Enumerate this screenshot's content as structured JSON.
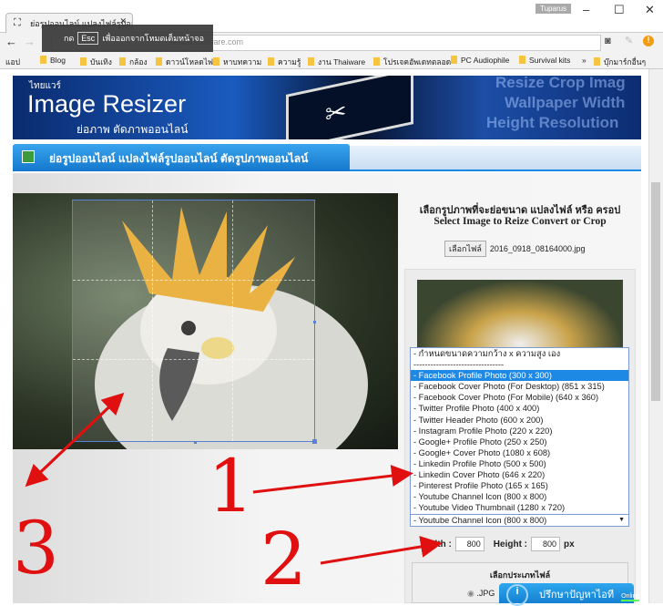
{
  "browser": {
    "tab_title": "ย่อรูปออนไลน์ แปลงไฟล์รูปออ",
    "user": "Tuparus",
    "url": "resize.thaiware.com",
    "esc_prefix": "กด",
    "esc_key": "Esc",
    "esc_text": "เพื่อออกจากโหมดเต็มหน้าจอ",
    "bookmarks": [
      "แอป",
      "Blog",
      "บันเทิง",
      "กล้อง",
      "ดาวน์โหลดไฟล์",
      "หาบทความ",
      "ความรู้",
      "งาน Thaiware",
      "โปรเจคอัพเดทตลอด",
      "PC Audiophile",
      "Survival kits",
      "»",
      "บุ๊กมาร์กอื่นๆ"
    ]
  },
  "banner": {
    "brand": "ไทยแวร์",
    "title": "Image Resizer",
    "subtitle": "ย่อภาพ ตัดภาพออนไลน์",
    "bg_text": [
      "Resize Crop Imag",
      "Wallpaper Width",
      "Height Resolution"
    ]
  },
  "section_title": "ย่อรูปออนไลน์ แปลงไฟล์รูปออนไลน์ ตัดรูปภาพออนไลน์",
  "panel": {
    "title_th": "เลือกรูปภาพที่จะย่อขนาด แปลงไฟล์ หรือ ครอป",
    "title_en": "Select Image to Reize Convert or Crop",
    "file_button": "เลือกไฟล์",
    "file_name": "2016_0918_08164000.jpg",
    "options": [
      "- กำหนดขนาดความกว้าง x ความสูง เอง",
      "--------------------------------",
      "- Facebook Profile Photo (300 x 300)",
      "- Facebook Cover Photo (For Desktop) (851 x 315)",
      "- Facebook Cover Photo (For Mobile) (640 x 360)",
      "- Twitter Profile Photo (400 x 400)",
      "- Twitter Header Photo (600 x 200)",
      "- Instagram Profile Photo (220 x 220)",
      "- Google+ Profile Photo (250 x 250)",
      "- Google+ Cover Photo (1080 x 608)",
      "- Linkedin Profile Photo (500 x 500)",
      "- Linkedin Cover Photo (646 x 220)",
      "- Pinterest Profile Photo (165 x 165)",
      "- Youtube Channel Icon (800 x 800)",
      "- Youtube Video Thumbnail (1280 x 720)"
    ],
    "highlighted_index": 2,
    "selected": "- Youtube Channel Icon (800 x 800)",
    "width_label": "Width :",
    "width": "800",
    "height_label": "Height :",
    "height": "800",
    "unit": "px",
    "filetype_label": "เลือกประเภทไฟล์",
    "filetype_option": ".JPG"
  },
  "chat": {
    "label": "ปรึกษาปัญหาไอที",
    "status": "Online"
  },
  "annotations": [
    "1",
    "2",
    "3"
  ],
  "colors": {
    "annotation": "#e01010",
    "accent": "#1e88e5"
  }
}
